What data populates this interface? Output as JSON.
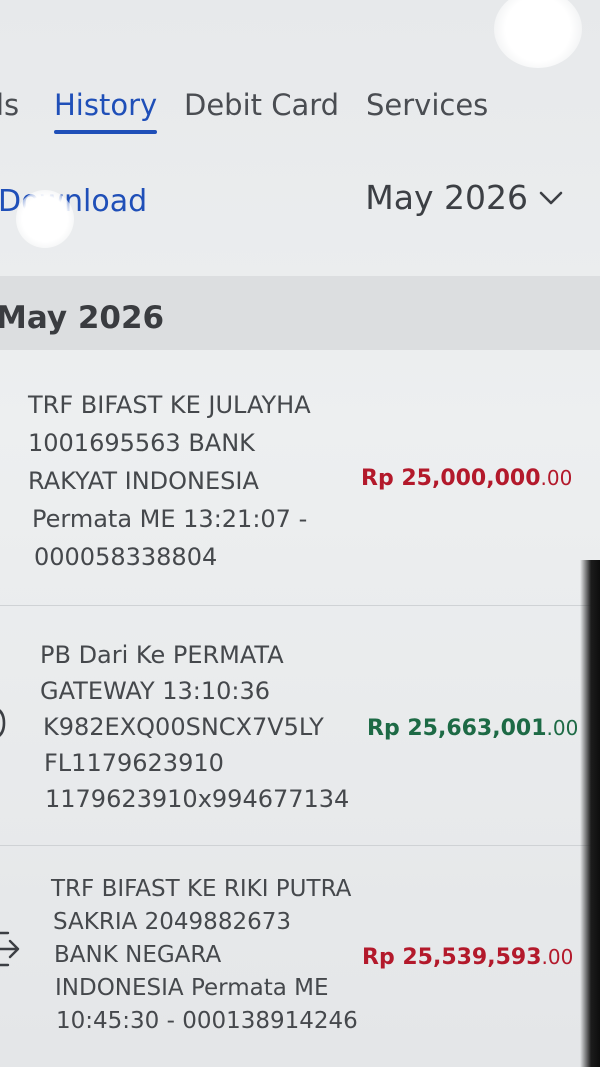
{
  "tabs": [
    {
      "label": "ls",
      "active": false
    },
    {
      "label": "History",
      "active": true
    },
    {
      "label": "Debit Card",
      "active": false
    },
    {
      "label": "Services",
      "active": false
    }
  ],
  "toolbar": {
    "download_label": "Download",
    "month_selected": "May 2026",
    "month_icon": "chevron-down-icon"
  },
  "group": {
    "title": "May 2026"
  },
  "transactions": [
    {
      "lines": [
        "TRF BIFAST KE JULAYHA",
        "1001695563 BANK",
        "RAKYAT INDONESIA",
        "Permata ME 13:21:07 -",
        "000058338804"
      ],
      "amount_main": "Rp 25,000,000",
      "amount_dec": ".00",
      "type": "debit"
    },
    {
      "lines": [
        "PB Dari  Ke  PERMATA",
        "GATEWAY 13:10:36",
        "K982EXQ00SNCX7V5LY",
        "FL1179623910",
        "1179623910x994677134"
      ],
      "amount_main": "Rp 25,663,001",
      "amount_dec": ".00",
      "type": "credit"
    },
    {
      "lines": [
        "TRF BIFAST KE RIKI PUTRA",
        "SAKRIA 2049882673",
        "BANK NEGARA",
        "INDONESIA Permata ME",
        "10:45:30 - 000138914246"
      ],
      "amount_main": "Rp 25,539,593",
      "amount_dec": ".00",
      "type": "debit"
    }
  ],
  "colors": {
    "accent": "#1f4fb8",
    "debit": "#b3192b",
    "credit": "#1d6a45"
  }
}
